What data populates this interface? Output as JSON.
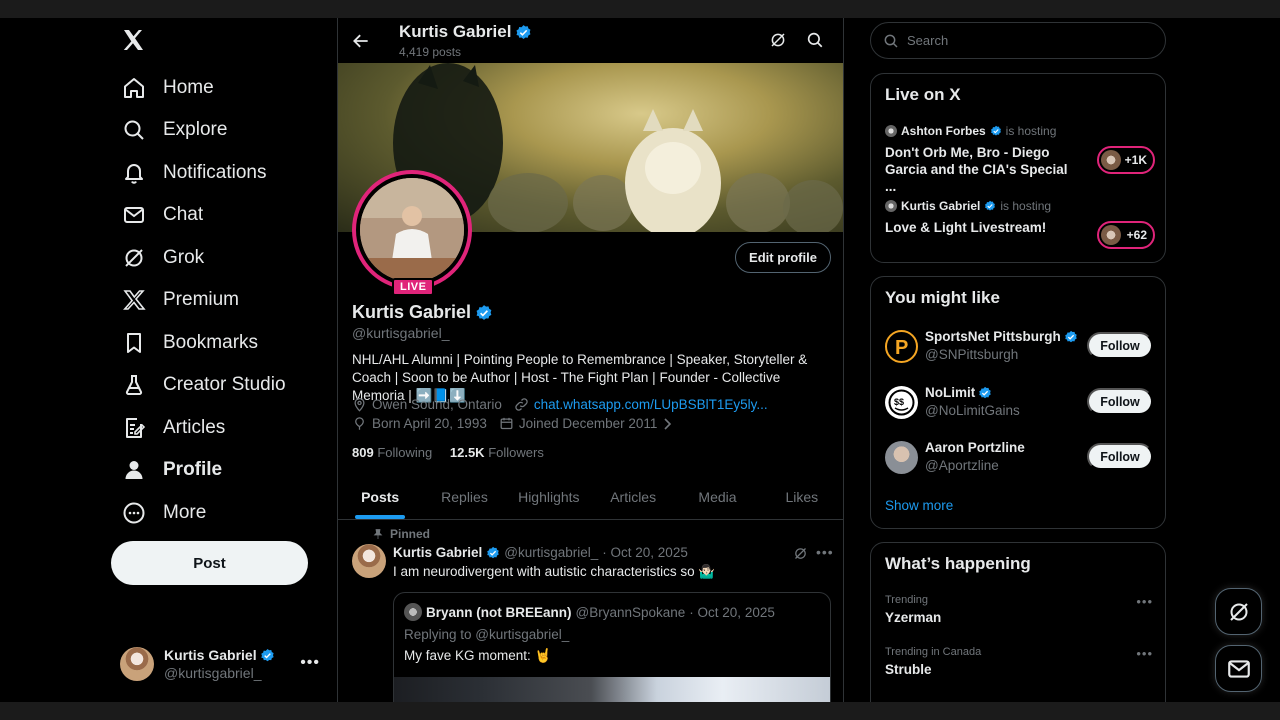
{
  "nav": {
    "items": [
      {
        "label": "Home"
      },
      {
        "label": "Explore"
      },
      {
        "label": "Notifications"
      },
      {
        "label": "Chat"
      },
      {
        "label": "Grok"
      },
      {
        "label": "Premium"
      },
      {
        "label": "Bookmarks"
      },
      {
        "label": "Creator Studio"
      },
      {
        "label": "Articles"
      },
      {
        "label": "Profile"
      },
      {
        "label": "More"
      }
    ],
    "post_label": "Post",
    "account": {
      "name": "Kurtis Gabriel",
      "handle": "@kurtisgabriel_"
    }
  },
  "header": {
    "title": "Kurtis Gabriel",
    "post_count": "4,419 posts"
  },
  "profile": {
    "live_label": "LIVE",
    "edit_label": "Edit profile",
    "name": "Kurtis Gabriel",
    "handle": "@kurtisgabriel_",
    "bio": "NHL/AHL Alumni | Pointing People to Remembrance | Speaker, Storyteller & Coach | Soon to be Author | Host - The Fight Plan | Founder - Collective Memoria | ➡️📘⬇️",
    "location": "Owen Sound, Ontario",
    "link": "chat.whatsapp.com/LUpBSBlT1Ey5ly...",
    "born": "Born April 20, 1993",
    "joined": "Joined December 2011",
    "following_count": "809",
    "following_label": "Following",
    "followers_count": "12.5K",
    "followers_label": "Followers"
  },
  "tabs": [
    "Posts",
    "Replies",
    "Highlights",
    "Articles",
    "Media",
    "Likes"
  ],
  "tweet": {
    "pinned_label": "Pinned",
    "name": "Kurtis Gabriel",
    "handle": "@kurtisgabriel_",
    "date": "· Oct 20, 2025",
    "text": "I am neurodivergent with autistic characteristics so 🤷🏻‍♂️",
    "quote": {
      "name": "Bryann (not BREEann)",
      "handle": "@BryannSpokane",
      "date": "· Oct 20, 2025",
      "reply": "Replying to @kurtisgabriel_",
      "text": "My fave KG moment: 🤘"
    }
  },
  "search": {
    "placeholder": "Search"
  },
  "live_on_x": {
    "title": "Live on X",
    "rows": [
      {
        "host": "Ashton Forbes",
        "suffix": "is hosting",
        "topic": "Don't Orb Me, Bro - Diego Garcia and the CIA's Special ...",
        "count": "+1K"
      },
      {
        "host": "Kurtis Gabriel",
        "suffix": "is hosting",
        "topic": "Love & Light Livestream!",
        "count": "+62"
      }
    ]
  },
  "you_might_like": {
    "title": "You might like",
    "users": [
      {
        "name": "SportsNet Pittsburgh",
        "handle": "@SNPittsburgh",
        "button": "Follow"
      },
      {
        "name": "NoLimit",
        "handle": "@NoLimitGains",
        "button": "Follow"
      },
      {
        "name": "Aaron Portzline",
        "handle": "@Aportzline",
        "button": "Follow"
      }
    ],
    "show_more": "Show more"
  },
  "whats_happening": {
    "title": "What’s happening",
    "trends": [
      {
        "category": "Trending",
        "name": "Yzerman"
      },
      {
        "category": "Trending in Canada",
        "name": "Struble"
      }
    ]
  },
  "colors": {
    "accent": "#1d9bf0",
    "live": "#e0247a",
    "bg": "#000000",
    "border": "#2f3336"
  }
}
